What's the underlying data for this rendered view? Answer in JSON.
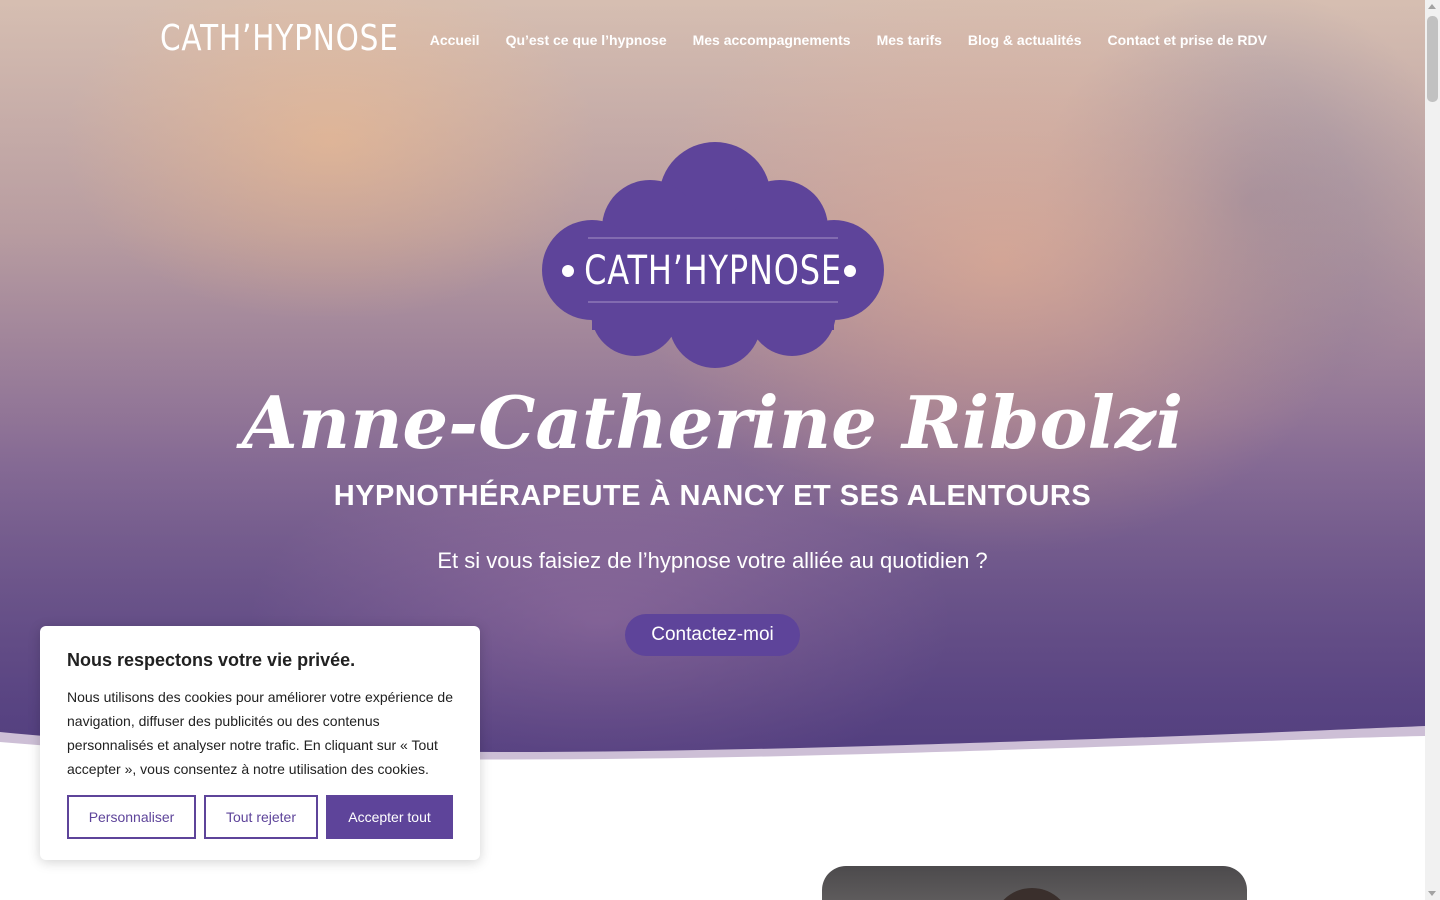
{
  "header": {
    "logo": "CATH’HYPNOSE",
    "nav": [
      {
        "label": "Accueil"
      },
      {
        "label": "Qu’est ce que l’hypnose"
      },
      {
        "label": "Mes accompagnements"
      },
      {
        "label": "Mes tarifs"
      },
      {
        "label": "Blog & actualités"
      },
      {
        "label": "Contact et prise de RDV"
      }
    ]
  },
  "hero": {
    "badge_logo": "CATH’HYPNOSE",
    "name": "Anne-Catherine Ribolzi",
    "subtitle": "HYPNOTHÉRAPEUTE À NANCY ET SES ALENTOURS",
    "tagline": "Et si vous faisiez de l’hypnose votre alliée au quotidien ?",
    "cta_label": "Contactez-moi"
  },
  "cookie_banner": {
    "title": "Nous respectons votre vie privée.",
    "text": "Nous utilisons des cookies pour améliorer votre expérience de navigation, diffuser des publicités ou des contenus personnalisés et analyser notre trafic. En cliquant sur « Tout accepter », vous consentez à notre utilisation des cookies.",
    "customize_label": "Personnaliser",
    "reject_label": "Tout rejeter",
    "accept_label": "Accepter tout"
  },
  "colors": {
    "brand_purple": "#5e449a",
    "text_dark": "#212121",
    "white": "#ffffff"
  }
}
